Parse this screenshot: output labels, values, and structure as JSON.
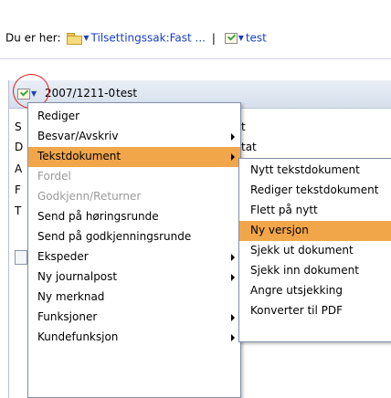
{
  "breadcrumb": {
    "prefix": "Du er her:",
    "link1": "Tilsettingssak:Fast ...",
    "separator": "|",
    "link2": "test"
  },
  "record": {
    "number": "2007/1211-0",
    "title": "test"
  },
  "background_fragments": [
    "S",
    "D",
    "A",
    "F",
    "T",
    "t",
    "tat"
  ],
  "menu": {
    "items": [
      {
        "label": "Rediger",
        "submenu": false,
        "disabled": false
      },
      {
        "label": "Besvar/Avskriv",
        "submenu": true,
        "disabled": false
      },
      {
        "label": "Tekstdokument",
        "submenu": true,
        "disabled": false,
        "active": true
      },
      {
        "label": "Fordel",
        "submenu": false,
        "disabled": true
      },
      {
        "label": "Godkjenn/Returner",
        "submenu": false,
        "disabled": true
      },
      {
        "label": "Send på høringsrunde",
        "submenu": false,
        "disabled": false
      },
      {
        "label": "Send på godkjenningsrunde",
        "submenu": false,
        "disabled": false
      },
      {
        "label": "Ekspeder",
        "submenu": true,
        "disabled": false
      },
      {
        "label": "Ny journalpost",
        "submenu": true,
        "disabled": false
      },
      {
        "label": "Ny merknad",
        "submenu": false,
        "disabled": false
      },
      {
        "label": "Funksjoner",
        "submenu": true,
        "disabled": false
      },
      {
        "label": "Kundefunksjon",
        "submenu": true,
        "disabled": false
      }
    ]
  },
  "submenu": {
    "items": [
      {
        "label": "Nytt tekstdokument"
      },
      {
        "label": "Rediger tekstdokument"
      },
      {
        "label": "Flett på nytt"
      },
      {
        "label": "Ny versjon",
        "active": true
      },
      {
        "label": "Sjekk ut dokument"
      },
      {
        "label": "Sjekk inn dokument"
      },
      {
        "label": "Angre utsjekking"
      },
      {
        "label": "Konverter til PDF"
      }
    ]
  },
  "colors": {
    "highlight": "#f2a64a",
    "link": "#1a3fbf",
    "annotation_circle": "#e41a1a",
    "disabled_text": "#9a9a9a"
  }
}
